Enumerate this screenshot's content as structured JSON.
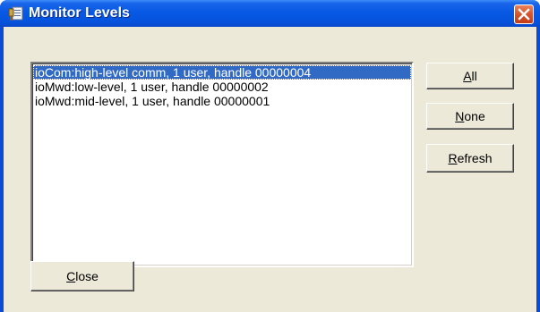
{
  "window": {
    "title": "Monitor Levels",
    "icon": "monitor-app-icon",
    "close_icon": "close-x-icon"
  },
  "list": {
    "items": [
      {
        "text": "ioCom:high-level comm, 1 user, handle 00000004",
        "selected": true
      },
      {
        "text": "ioMwd:low-level, 1 user, handle 00000002",
        "selected": false
      },
      {
        "text": "ioMwd:mid-level, 1 user, handle 00000001",
        "selected": false
      }
    ]
  },
  "buttons": {
    "all": {
      "accel": "A",
      "rest": "ll"
    },
    "none": {
      "accel": "N",
      "rest": "one"
    },
    "refresh": {
      "accel": "R",
      "rest": "efresh"
    },
    "close": {
      "accel": "C",
      "rest": "lose"
    }
  },
  "colors": {
    "titlebar": "#0758e4",
    "client": "#ece9d8",
    "selection": "#316ac5",
    "close_button": "#d9532a"
  }
}
